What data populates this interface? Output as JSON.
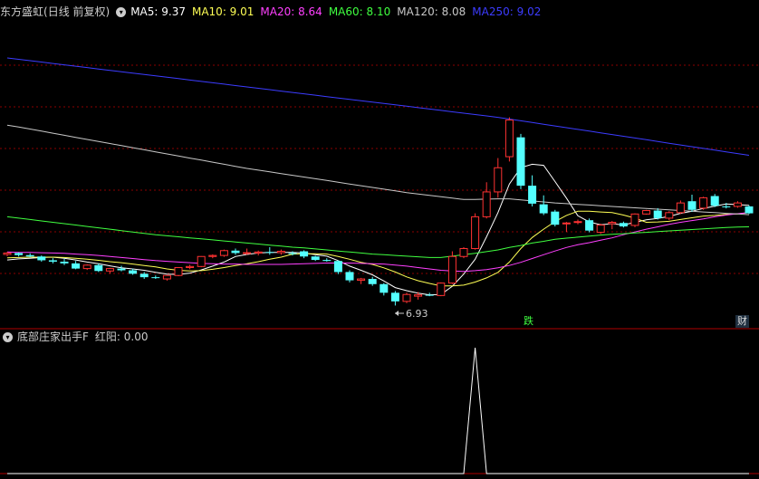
{
  "main_panel": {
    "stock_title": "东方盛虹",
    "period_label": "(日线 前复权)",
    "ma_legend": [
      {
        "text": "MA5: 9.37",
        "color": "#ffffff"
      },
      {
        "text": "MA10: 9.01",
        "color": "#ffff55"
      },
      {
        "text": "MA20: 8.64",
        "color": "#ff40ff"
      },
      {
        "text": "MA60: 8.10",
        "color": "#40ff40"
      },
      {
        "text": "MA120: 8.08",
        "color": "#c8c8c8"
      },
      {
        "text": "MA250: 9.02",
        "color": "#3c3cff"
      }
    ],
    "low_marker": "6.93",
    "tag_die": "跌",
    "tag_cai": "财"
  },
  "sub_panel": {
    "indicator_name": "底部庄家出手F",
    "value_text": "红阳: 0.00"
  },
  "colors": {
    "up": "#ff3232",
    "down": "#54ffff",
    "grid": "#8b0000",
    "border": "#b00000"
  },
  "chart_data": {
    "type": "candlestick",
    "candles": [
      [
        8.41,
        8.48,
        8.36,
        8.45
      ],
      [
        8.45,
        8.47,
        8.35,
        8.39
      ],
      [
        8.39,
        8.44,
        8.33,
        8.35
      ],
      [
        8.35,
        8.38,
        8.2,
        8.24
      ],
      [
        8.24,
        8.3,
        8.15,
        8.2
      ],
      [
        8.2,
        8.28,
        8.1,
        8.15
      ],
      [
        8.15,
        8.22,
        7.98,
        8.0
      ],
      [
        8.0,
        8.12,
        7.96,
        8.1
      ],
      [
        8.1,
        8.15,
        7.9,
        7.93
      ],
      [
        7.93,
        8.02,
        7.85,
        8.0
      ],
      [
        8.0,
        8.08,
        7.92,
        7.95
      ],
      [
        7.95,
        8.0,
        7.82,
        7.85
      ],
      [
        7.85,
        7.9,
        7.7,
        7.75
      ],
      [
        7.75,
        7.8,
        7.7,
        7.74
      ],
      [
        7.7,
        7.81,
        7.65,
        7.8
      ],
      [
        7.8,
        8.04,
        7.78,
        8.03
      ],
      [
        8.03,
        8.11,
        7.98,
        8.06
      ],
      [
        8.06,
        8.36,
        8.04,
        8.35
      ],
      [
        8.35,
        8.41,
        8.3,
        8.38
      ],
      [
        8.38,
        8.55,
        8.34,
        8.52
      ],
      [
        8.52,
        8.58,
        8.4,
        8.45
      ],
      [
        8.45,
        8.58,
        8.4,
        8.46
      ],
      [
        8.45,
        8.52,
        8.38,
        8.48
      ],
      [
        8.48,
        8.62,
        8.4,
        8.46
      ],
      [
        8.46,
        8.55,
        8.4,
        8.5
      ],
      [
        8.45,
        8.5,
        8.38,
        8.42
      ],
      [
        8.5,
        8.53,
        8.3,
        8.35
      ],
      [
        8.35,
        8.37,
        8.22,
        8.25
      ],
      [
        8.25,
        8.3,
        8.2,
        8.22
      ],
      [
        8.22,
        8.24,
        7.84,
        7.9
      ],
      [
        7.9,
        7.95,
        7.6,
        7.66
      ],
      [
        7.66,
        7.73,
        7.55,
        7.7
      ],
      [
        7.7,
        7.76,
        7.5,
        7.55
      ],
      [
        7.55,
        7.58,
        7.22,
        7.3
      ],
      [
        7.3,
        7.35,
        6.93,
        7.05
      ],
      [
        7.05,
        7.3,
        7.0,
        7.25
      ],
      [
        7.2,
        7.32,
        7.1,
        7.24
      ],
      [
        7.24,
        7.3,
        7.2,
        7.22
      ],
      [
        7.22,
        7.6,
        7.2,
        7.58
      ],
      [
        7.58,
        8.5,
        7.55,
        8.35
      ],
      [
        8.35,
        8.62,
        8.3,
        8.58
      ],
      [
        8.58,
        9.6,
        8.55,
        9.5
      ],
      [
        9.5,
        10.5,
        9.45,
        10.22
      ],
      [
        10.22,
        11.2,
        10.05,
        10.92
      ],
      [
        11.24,
        12.38,
        11.1,
        12.3
      ],
      [
        11.8,
        11.9,
        10.3,
        10.4
      ],
      [
        10.4,
        10.7,
        9.8,
        9.88
      ],
      [
        9.86,
        10.12,
        9.55,
        9.6
      ],
      [
        9.65,
        9.7,
        9.22,
        9.27
      ],
      [
        9.3,
        9.35,
        9.06,
        9.32
      ],
      [
        9.35,
        9.42,
        9.28,
        9.36
      ],
      [
        9.4,
        9.45,
        9.05,
        9.1
      ],
      [
        9.05,
        9.3,
        9.0,
        9.26
      ],
      [
        9.3,
        9.38,
        9.14,
        9.34
      ],
      [
        9.32,
        9.36,
        9.19,
        9.22
      ],
      [
        9.25,
        9.6,
        9.2,
        9.58
      ],
      [
        9.58,
        9.7,
        9.56,
        9.68
      ],
      [
        9.68,
        9.75,
        9.42,
        9.46
      ],
      [
        9.46,
        9.66,
        9.4,
        9.62
      ],
      [
        9.62,
        9.97,
        9.58,
        9.9
      ],
      [
        9.95,
        10.14,
        9.64,
        9.7
      ],
      [
        9.75,
        10.08,
        9.7,
        10.05
      ],
      [
        10.1,
        10.16,
        9.78,
        9.82
      ],
      [
        9.8,
        9.9,
        9.74,
        9.79
      ],
      [
        9.8,
        9.95,
        9.76,
        9.9
      ],
      [
        9.8,
        9.83,
        9.58,
        9.6
      ]
    ],
    "ma": {
      "MA5": [
        8.25,
        8.28,
        8.3,
        8.32,
        8.33,
        8.3,
        8.25,
        8.19,
        8.14,
        8.08,
        8.02,
        7.99,
        7.95,
        7.89,
        7.84,
        7.83,
        7.87,
        7.96,
        8.07,
        8.19,
        8.35,
        8.41,
        8.45,
        8.47,
        8.47,
        8.47,
        8.45,
        8.4,
        8.36,
        8.23,
        8.07,
        7.95,
        7.82,
        7.64,
        7.45,
        7.36,
        7.29,
        7.24,
        7.25,
        7.49,
        7.84,
        8.27,
        8.92,
        9.62,
        10.45,
        10.92,
        11.02,
        10.99,
        10.52,
        10.04,
        9.53,
        9.35,
        9.27,
        9.3,
        9.26,
        9.34,
        9.41,
        9.45,
        9.51,
        9.6,
        9.66,
        9.74,
        9.81,
        9.87,
        9.85,
        9.83
      ],
      "MA10": [
        8.31,
        8.32,
        8.33,
        8.33,
        8.33,
        8.32,
        8.3,
        8.27,
        8.24,
        8.2,
        8.17,
        8.13,
        8.09,
        8.05,
        7.99,
        7.95,
        7.93,
        7.94,
        7.98,
        8.03,
        8.09,
        8.14,
        8.2,
        8.27,
        8.33,
        8.42,
        8.43,
        8.43,
        8.42,
        8.35,
        8.27,
        8.18,
        8.12,
        8.02,
        7.9,
        7.76,
        7.65,
        7.57,
        7.5,
        7.5,
        7.52,
        7.61,
        7.73,
        7.89,
        8.19,
        8.58,
        8.9,
        9.14,
        9.36,
        9.54,
        9.66,
        9.66,
        9.64,
        9.62,
        9.55,
        9.46,
        9.34,
        9.35,
        9.37,
        9.42,
        9.47,
        9.52,
        9.54,
        9.57,
        9.58,
        9.62
      ],
      "MA20": [
        8.48,
        8.47,
        8.47,
        8.46,
        8.45,
        8.44,
        8.42,
        8.4,
        8.38,
        8.35,
        8.32,
        8.29,
        8.26,
        8.23,
        8.21,
        8.19,
        8.17,
        8.15,
        8.14,
        8.13,
        8.13,
        8.12,
        8.12,
        8.12,
        8.12,
        8.13,
        8.14,
        8.15,
        8.16,
        8.16,
        8.16,
        8.15,
        8.14,
        8.13,
        8.1,
        8.07,
        8.03,
        7.99,
        7.95,
        7.93,
        7.92,
        7.94,
        7.97,
        8.02,
        8.09,
        8.18,
        8.29,
        8.4,
        8.51,
        8.61,
        8.69,
        8.75,
        8.82,
        8.89,
        8.98,
        9.06,
        9.14,
        9.21,
        9.28,
        9.34,
        9.39,
        9.44,
        9.5,
        9.55,
        9.59,
        9.62
      ],
      "MA60": [
        9.5,
        9.46,
        9.42,
        9.38,
        9.34,
        9.3,
        9.26,
        9.22,
        9.18,
        9.14,
        9.1,
        9.06,
        9.02,
        8.98,
        8.95,
        8.92,
        8.89,
        8.86,
        8.83,
        8.8,
        8.77,
        8.74,
        8.71,
        8.68,
        8.65,
        8.62,
        8.6,
        8.57,
        8.54,
        8.51,
        8.48,
        8.45,
        8.42,
        8.4,
        8.38,
        8.36,
        8.34,
        8.32,
        8.32,
        8.36,
        8.4,
        8.44,
        8.49,
        8.54,
        8.61,
        8.67,
        8.74,
        8.79,
        8.85,
        8.88,
        8.91,
        8.94,
        8.97,
        8.99,
        9.01,
        9.03,
        9.05,
        9.07,
        9.09,
        9.11,
        9.13,
        9.15,
        9.17,
        9.19,
        9.2,
        9.21
      ],
      "MA120": [
        12.15,
        12.1,
        12.04,
        11.98,
        11.92,
        11.86,
        11.8,
        11.74,
        11.68,
        11.62,
        11.56,
        11.5,
        11.44,
        11.38,
        11.32,
        11.26,
        11.2,
        11.14,
        11.08,
        11.02,
        10.96,
        10.9,
        10.85,
        10.8,
        10.75,
        10.7,
        10.65,
        10.6,
        10.55,
        10.5,
        10.45,
        10.4,
        10.35,
        10.3,
        10.25,
        10.2,
        10.16,
        10.12,
        10.08,
        10.04,
        10.0,
        10.0,
        10.01,
        10.02,
        10.02,
        9.99,
        9.96,
        9.93,
        9.9,
        9.88,
        9.86,
        9.84,
        9.82,
        9.8,
        9.78,
        9.76,
        9.74,
        9.72,
        9.7,
        9.68,
        9.66,
        9.64,
        9.62,
        9.6,
        9.58,
        9.56
      ],
      "MA250": [
        14.1,
        14.06,
        14.02,
        13.98,
        13.94,
        13.9,
        13.86,
        13.82,
        13.78,
        13.74,
        13.7,
        13.66,
        13.62,
        13.58,
        13.54,
        13.5,
        13.46,
        13.42,
        13.38,
        13.34,
        13.3,
        13.26,
        13.22,
        13.18,
        13.14,
        13.1,
        13.06,
        13.02,
        12.98,
        12.94,
        12.9,
        12.86,
        12.82,
        12.78,
        12.74,
        12.7,
        12.66,
        12.62,
        12.58,
        12.54,
        12.5,
        12.46,
        12.42,
        12.38,
        12.33,
        12.28,
        12.23,
        12.18,
        12.13,
        12.08,
        12.03,
        11.98,
        11.93,
        11.88,
        11.83,
        11.78,
        11.73,
        11.68,
        11.63,
        11.58,
        11.53,
        11.48,
        11.43,
        11.38,
        11.33,
        11.28
      ]
    },
    "indicator": {
      "name": "红阳",
      "values": [
        0,
        0,
        0,
        0,
        0,
        0,
        0,
        0,
        0,
        0,
        0,
        0,
        0,
        0,
        0,
        0,
        0,
        0,
        0,
        0,
        0,
        0,
        0,
        0,
        0,
        0,
        0,
        0,
        0,
        0,
        0,
        0,
        0,
        0,
        0,
        0,
        0,
        0,
        0,
        0,
        0,
        1,
        0,
        0,
        0,
        0,
        0,
        0,
        0,
        0,
        0,
        0,
        0,
        0,
        0,
        0,
        0,
        0,
        0,
        0,
        0,
        0,
        0,
        0,
        0,
        0
      ]
    },
    "ylim": [
      6.6,
      15.2
    ]
  }
}
